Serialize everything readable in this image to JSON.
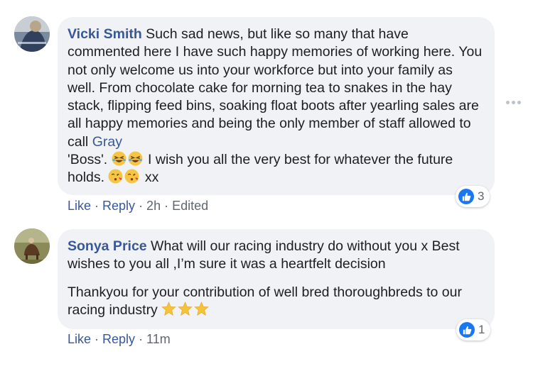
{
  "comments": [
    {
      "author": "Vicki Smith",
      "text_part1": " Such sad news, but like so many that have commented here I have such happy memories of working here. You not only welcome us into your workforce but into your family as well. From chocolate cake for morning tea to snakes in the hay stack, flipping feed bins, soaking float boots after yearling sales are all happy memories and being the only member of staff allowed to call ",
      "mention": "Gray",
      "text_part2": "'Boss'. ",
      "text_part3": " I wish you all the very best for whatever the future holds. ",
      "text_part4": " xx",
      "reaction_count": "3",
      "like_label": "Like",
      "reply_label": "Reply",
      "meta": " · 2h · Edited",
      "sep": " · "
    },
    {
      "author": "Sonya Price",
      "text_line1": " What will our racing industry do without you x Best wishes to you all ,I’m sure it was a heartfelt decision",
      "text_line2": "Thankyou for your contribution of well bred thoroughbreds to our racing industry ",
      "reaction_count": "1",
      "like_label": "Like",
      "reply_label": "Reply",
      "meta": " · 11m",
      "sep": " · "
    }
  ],
  "colors": {
    "link": "#385898",
    "bubble": "#f0f2f5",
    "like_blue": "#1877f2"
  },
  "icons": [
    "laughing-emoji-icon",
    "kiss-emoji-icon",
    "star-emoji-icon",
    "like-reaction-icon",
    "more-options-icon"
  ]
}
